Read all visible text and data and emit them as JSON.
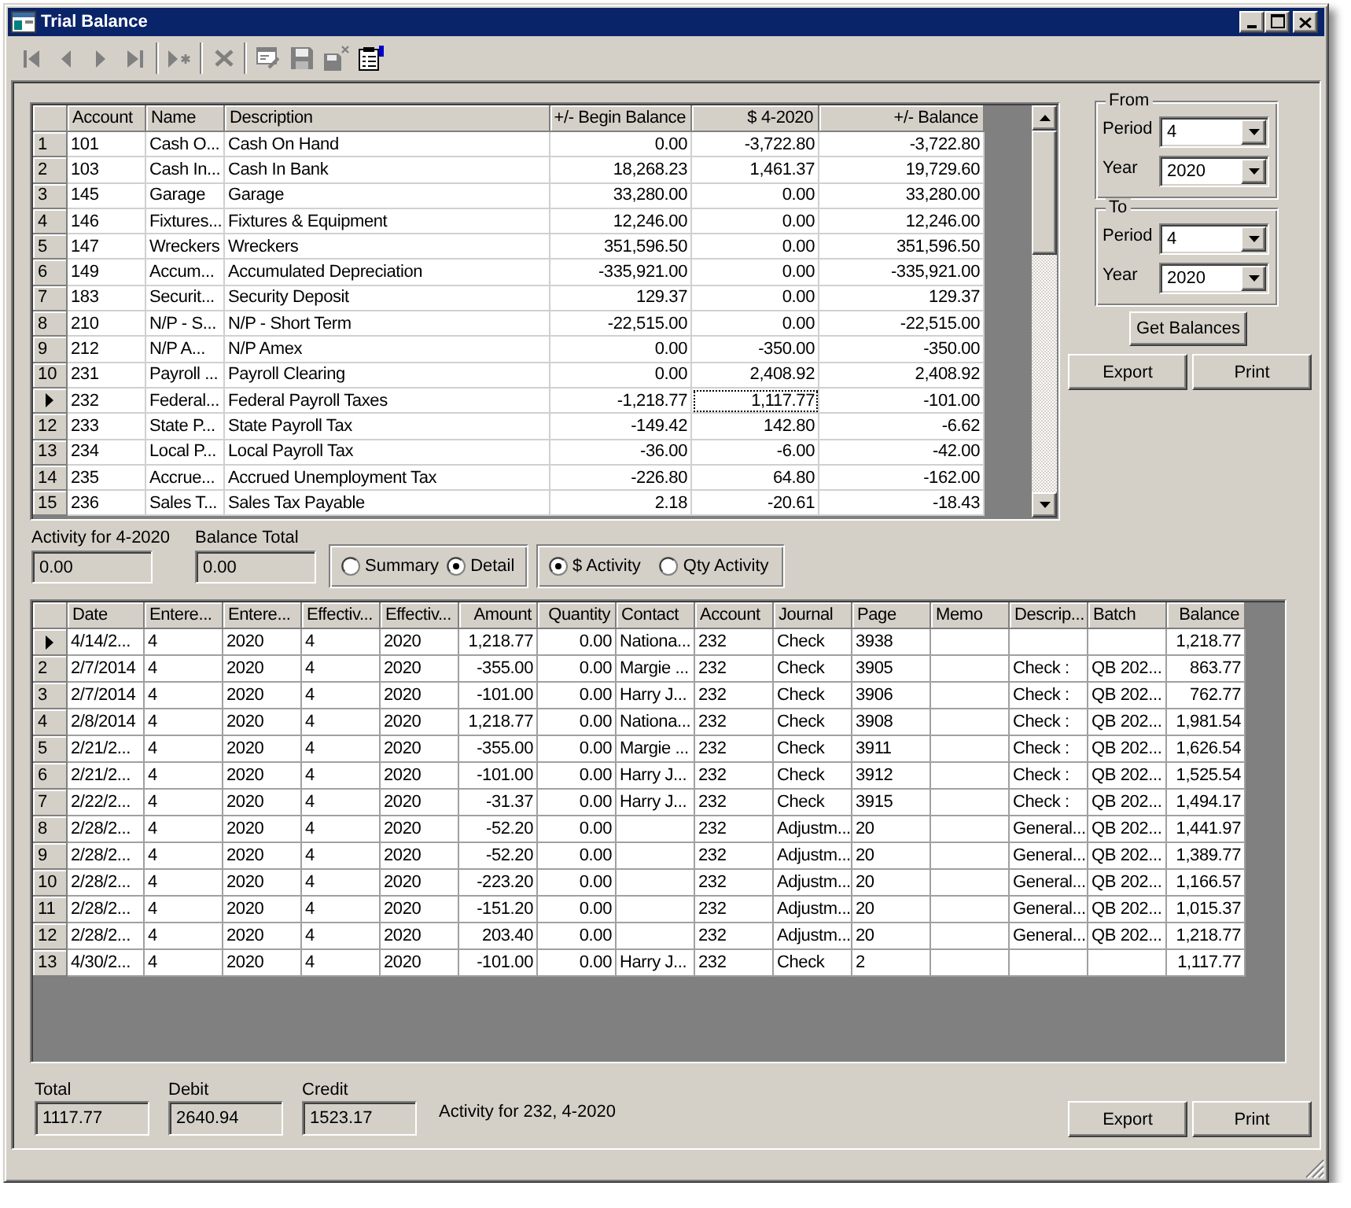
{
  "window": {
    "title": "Trial Balance"
  },
  "toolbar": {
    "groups": [
      {
        "buttons": [
          {
            "kind": "skip_start",
            "disabled": true
          },
          {
            "kind": "triangle_left",
            "disabled": true
          },
          {
            "kind": "triangle_right",
            "disabled": true
          },
          {
            "kind": "skip_end",
            "disabled": true
          }
        ]
      },
      {
        "buttons": [
          {
            "kind": "triangle_star",
            "disabled": true
          }
        ]
      },
      {
        "buttons": [
          {
            "kind": "cross",
            "disabled": true
          }
        ]
      },
      {
        "buttons": [
          {
            "kind": "form",
            "disabled": true
          },
          {
            "kind": "floppy",
            "disabled": true
          },
          {
            "kind": "floppy_x",
            "disabled": true
          },
          {
            "kind": "checklist",
            "disabled": false
          }
        ]
      }
    ]
  },
  "balances_table": {
    "columns": [
      {
        "label": "Account",
        "kind": "text",
        "focused": false
      },
      {
        "label": "Name",
        "kind": "text",
        "focused": false
      },
      {
        "label": "Description",
        "kind": "text",
        "focused": false
      },
      {
        "label": "+/- Begin Balance",
        "kind": "number",
        "focused": false
      },
      {
        "label": "$ 4-2020",
        "kind": "number",
        "focused": true
      },
      {
        "label": "+/- Balance",
        "kind": "number",
        "focused": false
      }
    ],
    "rows": [
      {
        "number": "1",
        "selected": false,
        "cells": [
          "101",
          "Cash O...",
          "Cash On Hand",
          "0.00",
          "-3,722.80",
          "-3,722.80"
        ]
      },
      {
        "number": "2",
        "selected": false,
        "cells": [
          "103",
          "Cash In...",
          "Cash In Bank",
          "18,268.23",
          "1,461.37",
          "19,729.60"
        ]
      },
      {
        "number": "3",
        "selected": false,
        "cells": [
          "145",
          "Garage",
          "Garage",
          "33,280.00",
          "0.00",
          "33,280.00"
        ]
      },
      {
        "number": "4",
        "selected": false,
        "cells": [
          "146",
          "Fixtures...",
          "Fixtures & Equipment",
          "12,246.00",
          "0.00",
          "12,246.00"
        ]
      },
      {
        "number": "5",
        "selected": false,
        "cells": [
          "147",
          "Wreckers",
          "Wreckers",
          "351,596.50",
          "0.00",
          "351,596.50"
        ]
      },
      {
        "number": "6",
        "selected": false,
        "cells": [
          "149",
          "Accum...",
          "Accumulated Depreciation",
          "-335,921.00",
          "0.00",
          "-335,921.00"
        ]
      },
      {
        "number": "7",
        "selected": false,
        "cells": [
          "183",
          "Securit...",
          "Security Deposit",
          "129.37",
          "0.00",
          "129.37"
        ]
      },
      {
        "number": "8",
        "selected": false,
        "cells": [
          "210",
          "N/P - S...",
          "N/P - Short Term",
          "-22,515.00",
          "0.00",
          "-22,515.00"
        ]
      },
      {
        "number": "9",
        "selected": false,
        "cells": [
          "212",
          "N/P A...",
          "N/P Amex",
          "0.00",
          "-350.00",
          "-350.00"
        ]
      },
      {
        "number": "10",
        "selected": false,
        "cells": [
          "231",
          "Payroll ...",
          "Payroll Clearing",
          "0.00",
          "2,408.92",
          "2,408.92"
        ]
      },
      {
        "selected": true,
        "cells": [
          "232",
          "Federal...",
          "Federal Payroll Taxes",
          "-1,218.77",
          "1,117.77",
          "-101.00"
        ]
      },
      {
        "number": "12",
        "selected": false,
        "cells": [
          "233",
          "State P...",
          "State Payroll Tax",
          "-149.42",
          "142.80",
          "-6.62"
        ]
      },
      {
        "number": "13",
        "selected": false,
        "cells": [
          "234",
          "Local P...",
          "Local Payroll Tax",
          "-36.00",
          "-6.00",
          "-42.00"
        ]
      },
      {
        "number": "14",
        "selected": false,
        "cells": [
          "235",
          "Accrue...",
          "Accrued Unemployment Tax",
          "-226.80",
          "64.80",
          "-162.00"
        ]
      },
      {
        "number": "15",
        "selected": false,
        "cells": [
          "236",
          "Sales T...",
          "Sales Tax Payable",
          "2.18",
          "-20.61",
          "-18.43"
        ]
      }
    ]
  },
  "period_range": {
    "groups": [
      {
        "title": "From",
        "fields": [
          {
            "label": "Period",
            "value": "4"
          },
          {
            "label": "Year",
            "value": "2020"
          }
        ]
      },
      {
        "title": "To",
        "fields": [
          {
            "label": "Period",
            "value": "4"
          },
          {
            "label": "Year",
            "value": "2020"
          }
        ]
      }
    ],
    "action": "Get Balances",
    "buttons": [
      "Export",
      "Print"
    ]
  },
  "summary_fields": [
    {
      "label": "Activity for 4-2020",
      "value": "0.00"
    },
    {
      "label": "Balance Total",
      "value": "0.00"
    }
  ],
  "view_options": [
    {
      "label": "Summary",
      "selected": false
    },
    {
      "label": "Detail",
      "selected": true
    }
  ],
  "activity_options": [
    {
      "label": "$ Activity",
      "selected": true
    },
    {
      "label": "Qty Activity",
      "selected": false
    }
  ],
  "activity_table": {
    "columns": [
      {
        "label": "Date",
        "kind": "text"
      },
      {
        "label": "Entere...",
        "kind": "text"
      },
      {
        "label": "Entere...",
        "kind": "text"
      },
      {
        "label": "Effectiv...",
        "kind": "text"
      },
      {
        "label": "Effectiv...",
        "kind": "text"
      },
      {
        "label": "Amount",
        "kind": "number"
      },
      {
        "label": "Quantity",
        "kind": "number"
      },
      {
        "label": "Contact",
        "kind": "text"
      },
      {
        "label": "Account",
        "kind": "text"
      },
      {
        "label": "Journal",
        "kind": "text"
      },
      {
        "label": "Page",
        "kind": "text"
      },
      {
        "label": "Memo",
        "kind": "text"
      },
      {
        "label": "Descrip...",
        "kind": "text"
      },
      {
        "label": "Batch",
        "kind": "text"
      },
      {
        "label": "Balance",
        "kind": "number"
      }
    ],
    "rows": [
      {
        "selected": true,
        "cells": [
          "4/14/2...",
          "4",
          "2020",
          "4",
          "2020",
          "1,218.77",
          "0.00",
          "Nationa...",
          "232",
          "Check",
          "3938",
          null,
          null,
          null,
          "1,218.77"
        ]
      },
      {
        "number": "2",
        "selected": false,
        "cells": [
          "2/7/2014",
          "4",
          "2020",
          "4",
          "2020",
          "-355.00",
          "0.00",
          "Margie ...",
          "232",
          "Check",
          "3905",
          null,
          "Check :",
          "QB 202...",
          "863.77"
        ]
      },
      {
        "number": "3",
        "selected": false,
        "cells": [
          "2/7/2014",
          "4",
          "2020",
          "4",
          "2020",
          "-101.00",
          "0.00",
          "Harry J...",
          "232",
          "Check",
          "3906",
          null,
          "Check :",
          "QB 202...",
          "762.77"
        ]
      },
      {
        "number": "4",
        "selected": false,
        "cells": [
          "2/8/2014",
          "4",
          "2020",
          "4",
          "2020",
          "1,218.77",
          "0.00",
          "Nationa...",
          "232",
          "Check",
          "3908",
          null,
          "Check :",
          "QB 202...",
          "1,981.54"
        ]
      },
      {
        "number": "5",
        "selected": false,
        "cells": [
          "2/21/2...",
          "4",
          "2020",
          "4",
          "2020",
          "-355.00",
          "0.00",
          "Margie ...",
          "232",
          "Check",
          "3911",
          null,
          "Check :",
          "QB 202...",
          "1,626.54"
        ]
      },
      {
        "number": "6",
        "selected": false,
        "cells": [
          "2/21/2...",
          "4",
          "2020",
          "4",
          "2020",
          "-101.00",
          "0.00",
          "Harry J...",
          "232",
          "Check",
          "3912",
          null,
          "Check :",
          "QB 202...",
          "1,525.54"
        ]
      },
      {
        "number": "7",
        "selected": false,
        "cells": [
          "2/22/2...",
          "4",
          "2020",
          "4",
          "2020",
          "-31.37",
          "0.00",
          "Harry J...",
          "232",
          "Check",
          "3915",
          null,
          "Check :",
          "QB 202...",
          "1,494.17"
        ]
      },
      {
        "number": "8",
        "selected": false,
        "cells": [
          "2/28/2...",
          "4",
          "2020",
          "4",
          "2020",
          "-52.20",
          "0.00",
          null,
          "232",
          "Adjustm...",
          "20",
          null,
          "General...",
          "QB 202...",
          "1,441.97"
        ]
      },
      {
        "number": "9",
        "selected": false,
        "cells": [
          "2/28/2...",
          "4",
          "2020",
          "4",
          "2020",
          "-52.20",
          "0.00",
          null,
          "232",
          "Adjustm...",
          "20",
          null,
          "General...",
          "QB 202...",
          "1,389.77"
        ]
      },
      {
        "number": "10",
        "selected": false,
        "cells": [
          "2/28/2...",
          "4",
          "2020",
          "4",
          "2020",
          "-223.20",
          "0.00",
          null,
          "232",
          "Adjustm...",
          "20",
          null,
          "General...",
          "QB 202...",
          "1,166.57"
        ]
      },
      {
        "number": "11",
        "selected": false,
        "cells": [
          "2/28/2...",
          "4",
          "2020",
          "4",
          "2020",
          "-151.20",
          "0.00",
          null,
          "232",
          "Adjustm...",
          "20",
          null,
          "General...",
          "QB 202...",
          "1,015.37"
        ]
      },
      {
        "number": "12",
        "selected": false,
        "cells": [
          "2/28/2...",
          "4",
          "2020",
          "4",
          "2020",
          "203.40",
          "0.00",
          null,
          "232",
          "Adjustm...",
          "20",
          null,
          "General...",
          "QB 202...",
          "1,218.77"
        ]
      },
      {
        "number": "13",
        "selected": false,
        "cells": [
          "4/30/2...",
          "4",
          "2020",
          "4",
          "2020",
          "-101.00",
          "0.00",
          "Harry J...",
          "232",
          "Check",
          "2",
          null,
          null,
          null,
          "1,117.77"
        ]
      }
    ]
  },
  "totals": [
    {
      "label": "Total",
      "value": "1117.77"
    },
    {
      "label": "Debit",
      "value": "2640.94"
    },
    {
      "label": "Credit",
      "value": "1523.17"
    }
  ],
  "status_text": "Activity for 232, 4-2020",
  "footer_buttons": [
    "Export",
    "Print"
  ]
}
